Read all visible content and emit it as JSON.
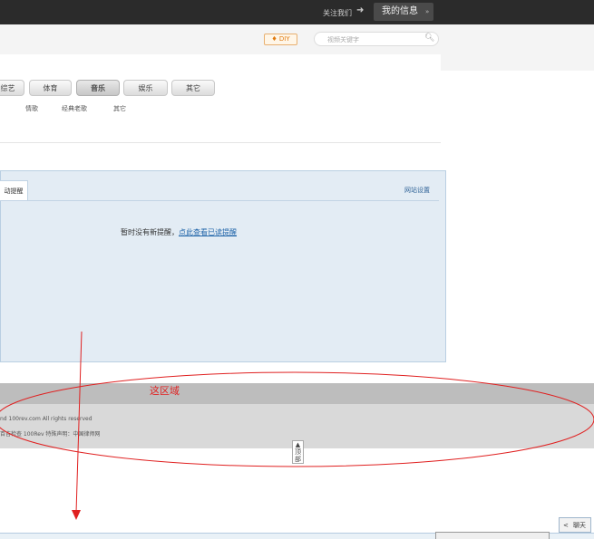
{
  "topbar": {
    "follow_label": "关注我们",
    "follow_arrow": "➜",
    "myinfo_label": "我的信息",
    "myinfo_chevron": "»"
  },
  "header": {
    "diy_label": "♦ DIY",
    "search_placeholder": "视频关键字",
    "search_icon": "search-icon"
  },
  "categories": [
    {
      "label": "综艺"
    },
    {
      "label": "体育"
    },
    {
      "label": "音乐",
      "active": true
    },
    {
      "label": "娱乐"
    },
    {
      "label": "其它"
    }
  ],
  "subcategories": [
    "情歌",
    "经典老歌",
    "其它"
  ],
  "notice": {
    "tab_label": "动提醒",
    "settings_link": "网站设置",
    "empty_prefix": "暂时没有新提醒，",
    "empty_link": "点此查看已读提醒"
  },
  "footer": {
    "copyright": "nd 100rev.com All rights reserved",
    "credits": "百吉检查 100Rev  特殊声明：中国律师网",
    "totop": "顶部"
  },
  "annotation": {
    "label": "这区域",
    "color": "#e02020"
  },
  "chat": {
    "left_arrow": "<",
    "label": "聊天"
  }
}
